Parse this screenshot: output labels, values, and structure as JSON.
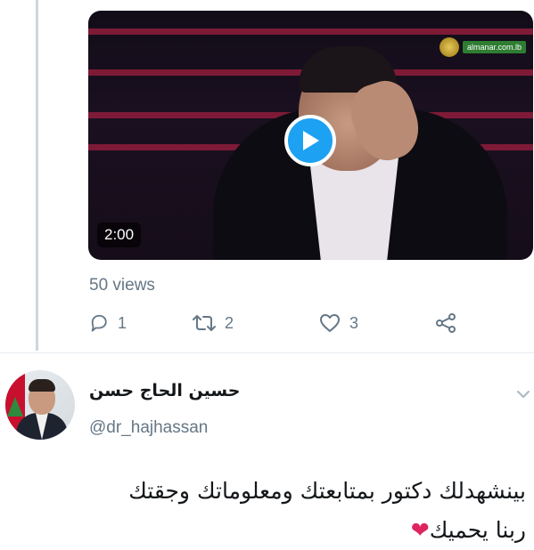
{
  "video": {
    "duration": "2:00",
    "channel_url": "almanar.com.lb"
  },
  "stats": {
    "views": "50 views"
  },
  "actions": {
    "reply_count": "1",
    "retweet_count": "2",
    "like_count": "3"
  },
  "tweet": {
    "display_name": "حسين الحاج حسن",
    "handle": "@dr_hajhassan",
    "text_line1": "بينشهدلك دكتور بمتابعتك ومعلوماتك وجقتك",
    "text_line2": "ربنا يحميك",
    "emoji": "❤"
  },
  "colors": {
    "accent": "#1da1f2",
    "muted": "#657786",
    "heart": "#e0245e"
  },
  "icons": {
    "reply": "reply-icon",
    "retweet": "retweet-icon",
    "like": "like-icon",
    "share": "share-icon",
    "play": "play-icon",
    "chevron": "chevron-down-icon"
  }
}
